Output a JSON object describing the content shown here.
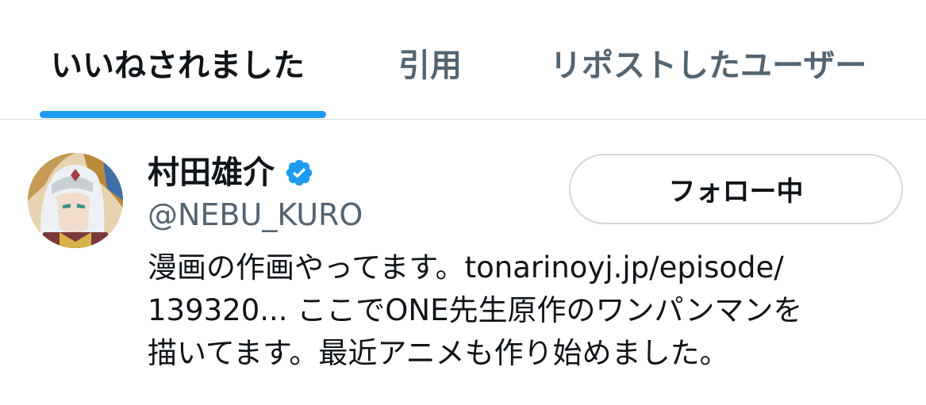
{
  "tabs": [
    {
      "label": "いいねされました",
      "active": true
    },
    {
      "label": "引用",
      "active": false
    },
    {
      "label": "リポストしたユーザー",
      "active": false
    }
  ],
  "user": {
    "display_name": "村田雄介",
    "verified_icon": "verified-badge-icon",
    "handle": "@NEBU_KURO",
    "follow_button_label": "フォロー中",
    "bio_lines": [
      "漫画の作画やってます。tonarinoyj.jp/episode/",
      "139320... ここでONE先生原作のワンパンマンを",
      "描いてます。最近アニメも作り始めました。"
    ]
  },
  "colors": {
    "accent": "#1d9bf0",
    "text_primary": "#0f1419",
    "text_secondary": "#536471",
    "border": "#cfd9de"
  }
}
